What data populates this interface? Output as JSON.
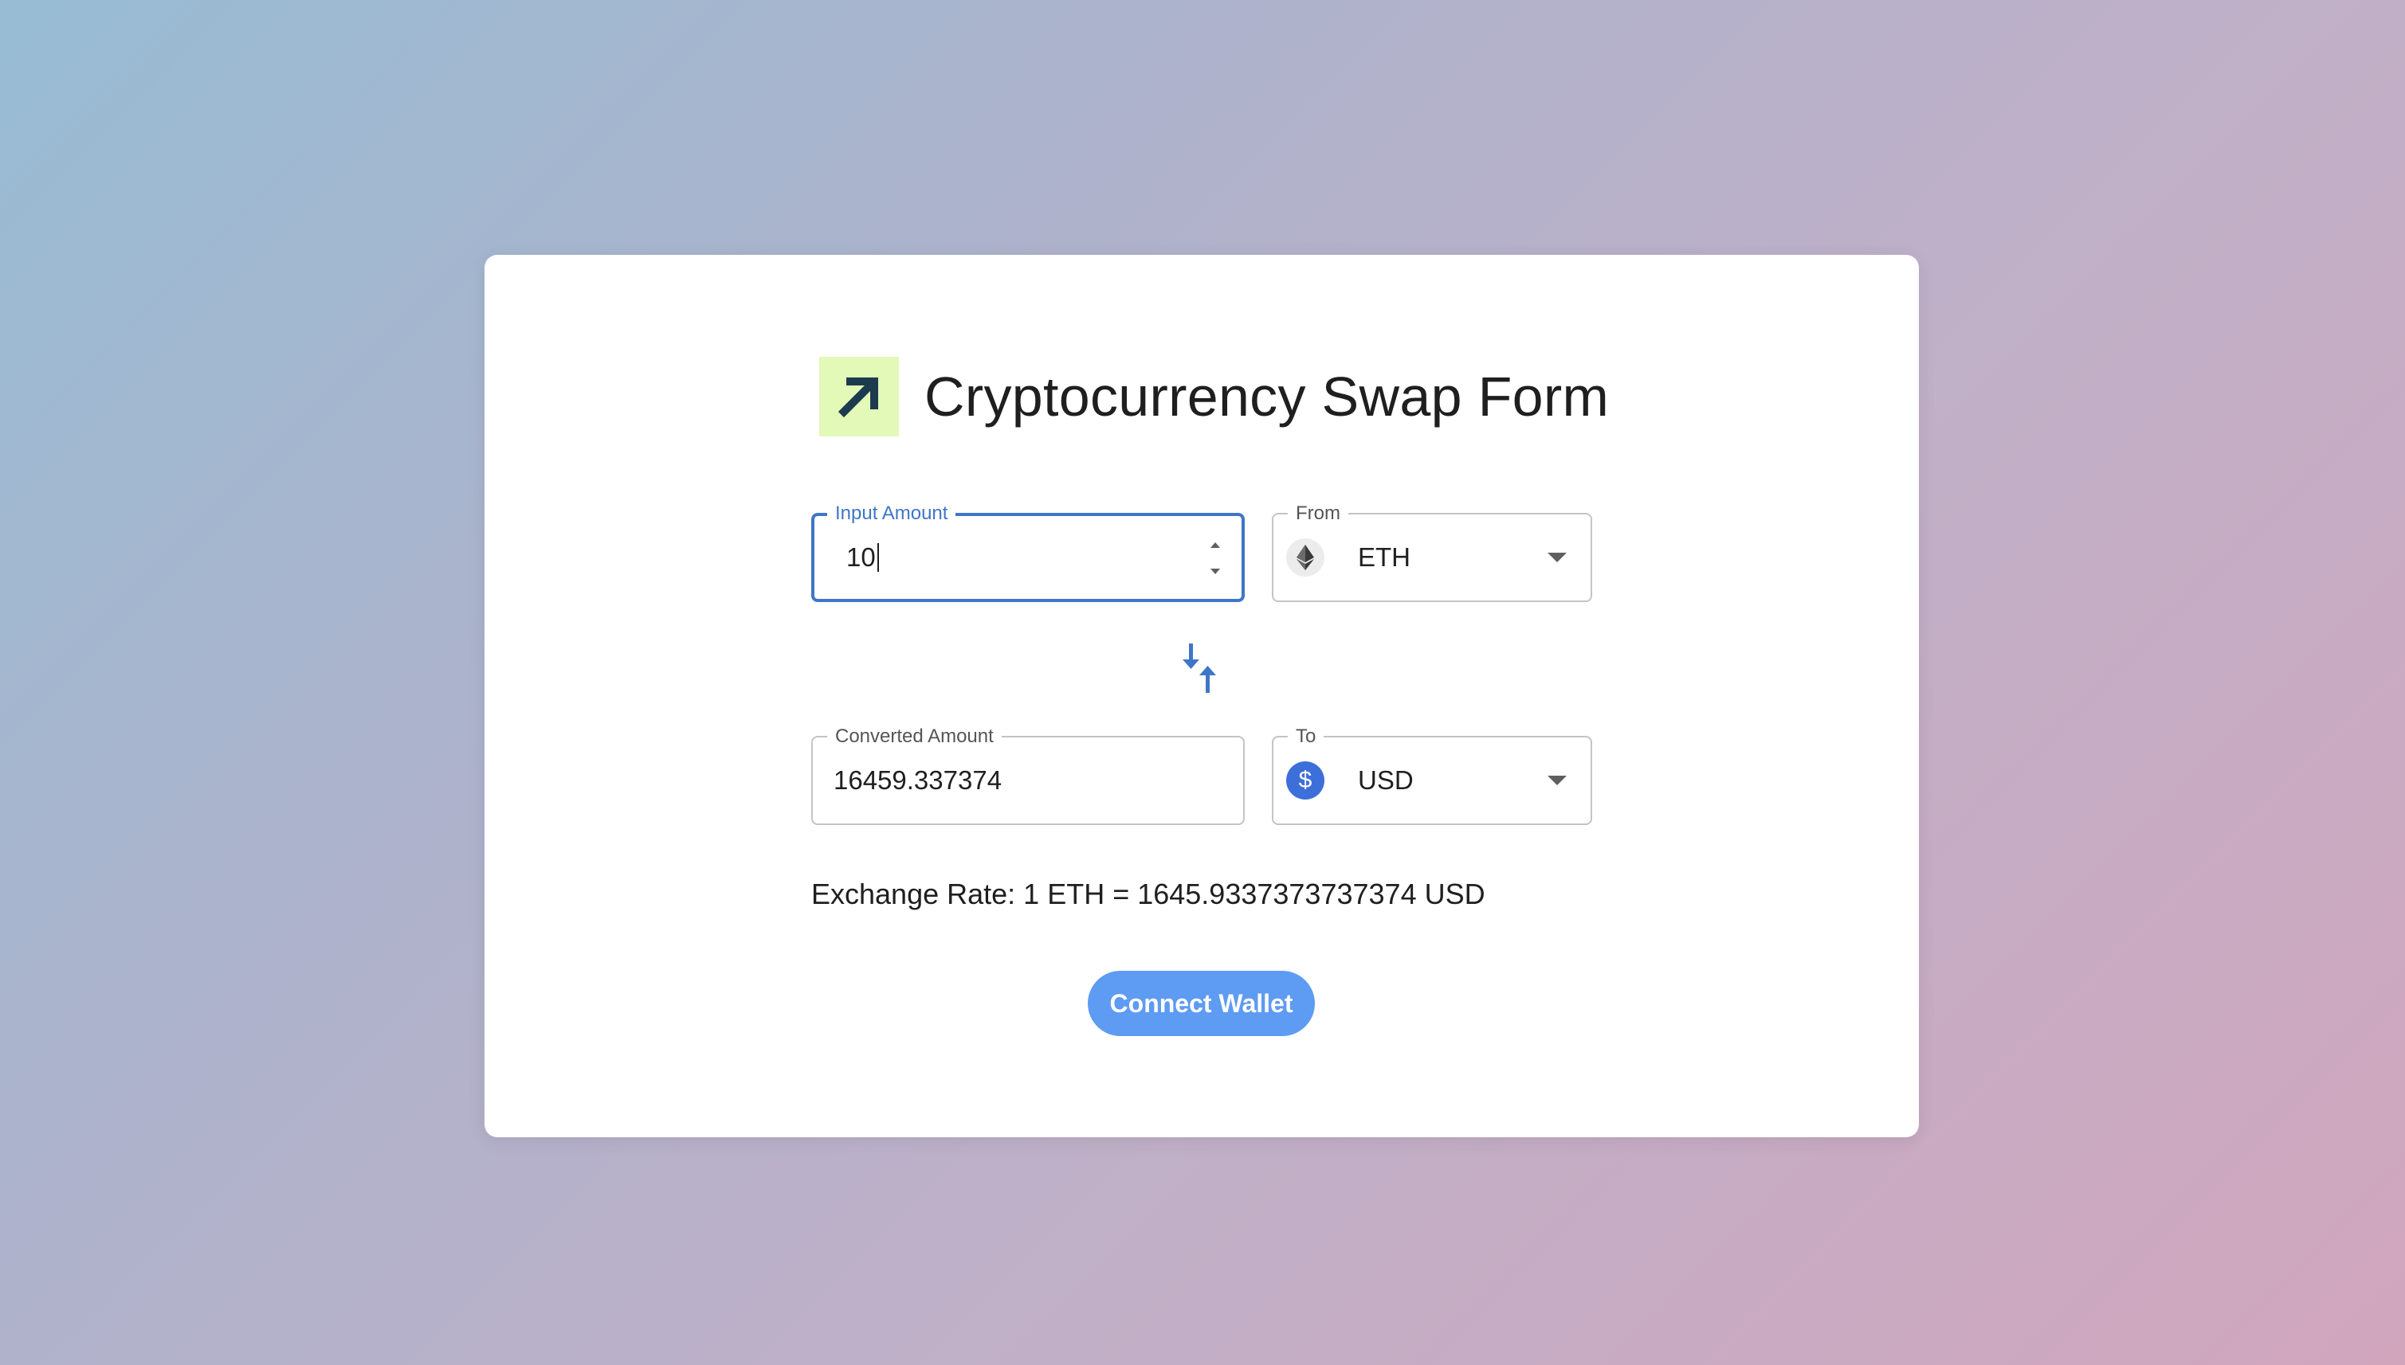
{
  "header": {
    "title": "Cryptocurrency Swap Form",
    "logo_icon": "arrow-up-right-icon",
    "logo_bg": "#e2f9b8",
    "logo_fg": "#1d3b4e"
  },
  "input_amount": {
    "label": "Input Amount",
    "value": "10"
  },
  "from_select": {
    "label": "From",
    "value": "ETH",
    "icon": "ethereum-icon"
  },
  "swap": {
    "icon": "swap-vertical-icon",
    "color": "#3f76c7"
  },
  "converted_amount": {
    "label": "Converted Amount",
    "value": "16459.337374"
  },
  "to_select": {
    "label": "To",
    "value": "USD",
    "icon": "dollar-coin-icon",
    "icon_color": "#3d6fd9"
  },
  "exchange_rate": {
    "text": "Exchange Rate: 1 ETH = 1645.9337373737374 USD"
  },
  "connect_button": {
    "label": "Connect Wallet",
    "color": "#5e9bf2"
  },
  "theme": {
    "accent": "#3f76c7"
  }
}
